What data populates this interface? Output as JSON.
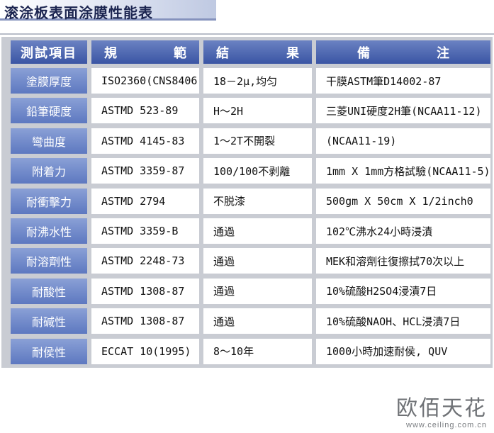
{
  "title": "滚涂板表面涂膜性能表",
  "header": {
    "col1": "測試項目",
    "col2": [
      "規",
      "範"
    ],
    "col3": [
      "結",
      "果"
    ],
    "col4": [
      "備",
      "注"
    ]
  },
  "rows": [
    {
      "item": "塗膜厚度",
      "standard": "ISO2360(CNS8406)",
      "result": "18－2μ,均匀",
      "note": "干膜ASTM筆D14002-87"
    },
    {
      "item": "鉛筆硬度",
      "standard": "ASTMD 523-89",
      "result": "H～2H",
      "note": "三菱UNI硬度2H筆(NCAA11-12)"
    },
    {
      "item": "彎曲度",
      "standard": "ASTMD 4145-83",
      "result": "1～2T不開裂",
      "note": "(NCAA11-19)"
    },
    {
      "item": "附着力",
      "standard": "ASTMD 3359-87",
      "result": "100/100不剥離",
      "note": "1mm X 1mm方格試驗(NCAA11-5)"
    },
    {
      "item": "耐衝擊力",
      "standard": "ASTMD 2794",
      "result": "不脱漆",
      "note": "500gm X 50cm X 1/2inch0"
    },
    {
      "item": "耐沸水性",
      "standard": "ASTMD 3359-B",
      "result": "通過",
      "note": "102℃沸水24小時浸漬"
    },
    {
      "item": "耐溶劑性",
      "standard": "ASTMD 2248-73",
      "result": "通過",
      "note": "MEK和溶劑往復擦拭70次以上"
    },
    {
      "item": "耐酸性",
      "standard": "ASTMD 1308-87",
      "result": "通過",
      "note": "10%硫酸H2SO4浸漬7日"
    },
    {
      "item": "耐碱性",
      "standard": "ASTMD 1308-87",
      "result": "通過",
      "note": "10%硫酸NAOH、HCL浸漬7日"
    },
    {
      "item": "耐侯性",
      "standard": "ECCAT 10(1995)",
      "result": "8～10年",
      "note": "1000小時加速耐侯, QUV"
    }
  ],
  "watermark": {
    "brand": "欧佰天花",
    "url": "www.ceiling.com.cn"
  }
}
